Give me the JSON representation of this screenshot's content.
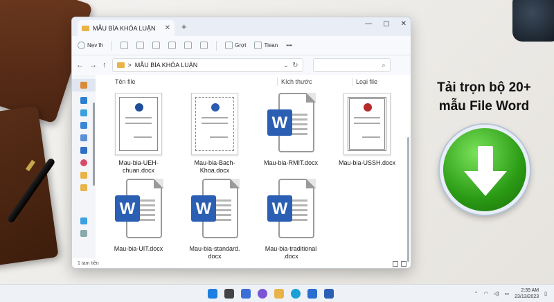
{
  "window": {
    "tab_title": "MẪU BÌA KHÓA LUẬN",
    "new_tab": "+",
    "close_tab": "✕",
    "controls": [
      "—",
      "▢",
      "✕"
    ]
  },
  "toolbar": {
    "new_label": "Nẹv ĩh",
    "sort_label": "Grợt",
    "view_label": "Tiean",
    "more_label": "•••"
  },
  "address": {
    "path": "MẪU BÌA KHÓA LUẬN",
    "separator": ">"
  },
  "columns": {
    "name": "Tên file",
    "size": "Kích thước",
    "type": "Loại file"
  },
  "files": [
    {
      "name": "Mau-bia-UEH-chuan.docx",
      "line1": "Mau-bia-UEH-",
      "line2": "chuan.docx",
      "kind": "thumb"
    },
    {
      "name": "Mau-bia-Bach-Khoa.docx",
      "line1": "Mau-bia-Bach-",
      "line2": "Khoa.docx",
      "kind": "thumb"
    },
    {
      "name": "Mau-bia-RMIT.docx",
      "line1": "Mau-bia-RMIT.docx",
      "line2": "",
      "kind": "word"
    },
    {
      "name": "Mau-bia-USSH.docx",
      "line1": "Mau-bia-USSH.docx",
      "line2": "",
      "kind": "thumb"
    },
    {
      "name": "Mau-bia-UIT.docx",
      "line1": "Mau-bia-UIT.docx",
      "line2": "",
      "kind": "word"
    },
    {
      "name": "Mau-bia-standard.docx",
      "line1": "Mau-bia-standard.",
      "line2": "docx",
      "kind": "word"
    },
    {
      "name": "Mau-bia-traditional.docx",
      "line1": "Mau-bia-traditional",
      "line2": ".docx",
      "kind": "word"
    }
  ],
  "word_letter": "W",
  "status": {
    "count": "1 tam tiền"
  },
  "promo": {
    "line1": "Tải trọn bộ 20+",
    "line2": "mẫu File Word"
  },
  "taskbar": {
    "time": "2:39 AM",
    "date": "23/13/2023"
  }
}
